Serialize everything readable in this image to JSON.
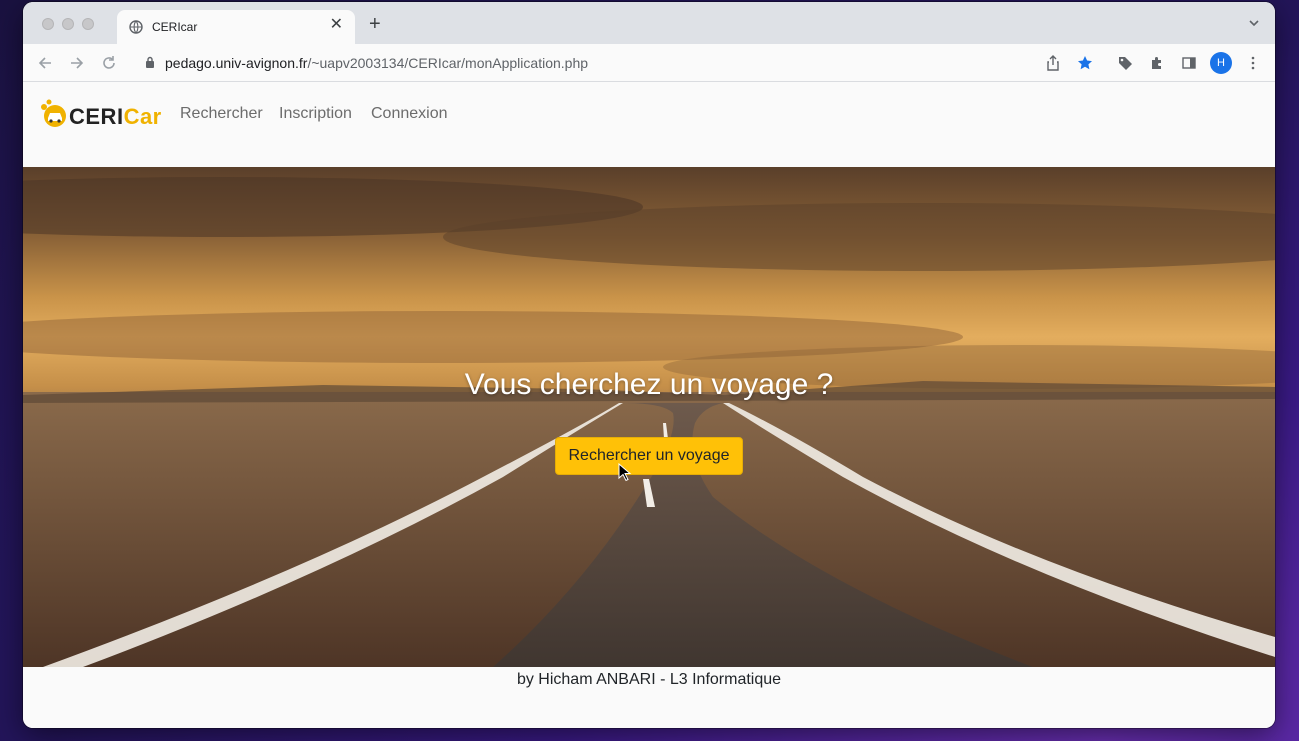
{
  "browser": {
    "tab_title": "CERIcar",
    "url_host": "pedago.univ-avignon.fr",
    "url_path": "/~uapv2003134/CERIcar/monApplication.php",
    "profile_initial": "H",
    "icons": [
      "globe-icon",
      "close-icon",
      "new-tab-icon",
      "tab-menu-icon",
      "back-icon",
      "forward-icon",
      "reload-icon",
      "lock-icon",
      "share-icon",
      "bookmark-star-icon",
      "tag-icon",
      "extensions-icon",
      "side-panel-icon",
      "kebab-menu-icon"
    ]
  },
  "site": {
    "logo_ceri": "CERI",
    "logo_car": "Car",
    "nav": [
      "Rechercher",
      "Inscription",
      "Connexion"
    ],
    "hero_title": "Vous cherchez un voyage ?",
    "hero_button": "Rechercher un voyage",
    "footer": "by Hicham ANBARI - L3 Informatique"
  },
  "colors": {
    "accent": "#ffc107",
    "logo_accent": "#f0b200",
    "profile": "#1a73e8",
    "bookmark_star": "#1a73e8"
  }
}
